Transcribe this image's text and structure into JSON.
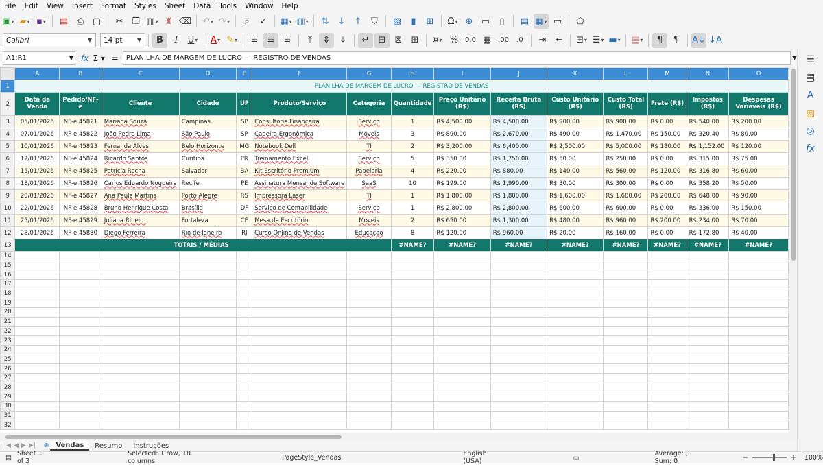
{
  "menu": [
    "File",
    "Edit",
    "View",
    "Insert",
    "Format",
    "Styles",
    "Sheet",
    "Data",
    "Tools",
    "Window",
    "Help"
  ],
  "toolbar": {
    "font_name": "Calibri",
    "font_size": "14 pt"
  },
  "formula_bar": {
    "name_box": "A1:R1",
    "content": "PLANILHA DE MARGEM DE LUCRO — REGISTRO DE VENDAS"
  },
  "columns": [
    "A",
    "B",
    "C",
    "D",
    "E",
    "F",
    "G",
    "H",
    "I",
    "J",
    "K",
    "L",
    "M",
    "N",
    "O"
  ],
  "title": "PLANILHA DE MARGEM DE LUCRO — REGISTRO DE VENDAS",
  "headers": [
    "Data da Venda",
    "Pedido/NF-e",
    "Cliente",
    "Cidade",
    "UF",
    "Produto/Serviço",
    "Categoria",
    "Quantidade",
    "Preço Unitário (R$)",
    "Receita Bruta (R$)",
    "Custo Unitário (R$)",
    "Custo Total (R$)",
    "Frete (R$)",
    "Impostos (R$)",
    "Despesas Variáveis (R$)"
  ],
  "rows": [
    [
      "05/01/2026",
      "NF-e 45821",
      "Mariana Souza",
      "Campinas",
      "SP",
      "Consultoria Financeira",
      "Serviço",
      "1",
      "R$ 4,500.00",
      "R$ 4,500.00",
      "R$ 900.00",
      "R$ 900.00",
      "R$ 0.00",
      "R$ 540.00",
      "R$ 200.00"
    ],
    [
      "07/01/2026",
      "NF-e 45822",
      "João Pedro Lima",
      "São Paulo",
      "SP",
      "Cadeira Ergonômica",
      "Móveis",
      "3",
      "R$ 890.00",
      "R$ 2,670.00",
      "R$ 490.00",
      "R$ 1,470.00",
      "R$ 150.00",
      "R$ 320.40",
      "R$ 80.00"
    ],
    [
      "10/01/2026",
      "NF-e 45823",
      "Fernanda Alves",
      "Belo Horizonte",
      "MG",
      "Notebook Dell",
      "TI",
      "2",
      "R$ 3,200.00",
      "R$ 6,400.00",
      "R$ 2,500.00",
      "R$ 5,000.00",
      "R$ 180.00",
      "R$ 1,152.00",
      "R$ 120.00"
    ],
    [
      "12/01/2026",
      "NF-e 45824",
      "Ricardo Santos",
      "Curitiba",
      "PR",
      "Treinamento Excel",
      "Serviço",
      "5",
      "R$ 350.00",
      "R$ 1,750.00",
      "R$ 50.00",
      "R$ 250.00",
      "R$ 0.00",
      "R$ 315.00",
      "R$ 75.00"
    ],
    [
      "15/01/2026",
      "NF-e 45825",
      "Patrícia Rocha",
      "Salvador",
      "BA",
      "Kit Escritório Premium",
      "Papelaria",
      "4",
      "R$ 220.00",
      "R$ 880.00",
      "R$ 140.00",
      "R$ 560.00",
      "R$ 120.00",
      "R$ 316.80",
      "R$ 60.00"
    ],
    [
      "18/01/2026",
      "NF-e 45826",
      "Carlos Eduardo Nogueira",
      "Recife",
      "PE",
      "Assinatura Mensal de Software",
      "SaaS",
      "10",
      "R$ 199.00",
      "R$ 1,990.00",
      "R$ 30.00",
      "R$ 300.00",
      "R$ 0.00",
      "R$ 358.20",
      "R$ 50.00"
    ],
    [
      "20/01/2026",
      "NF-e 45827",
      "Ana Paula Martins",
      "Porto Alegre",
      "RS",
      "Impressora Laser",
      "TI",
      "1",
      "R$ 1,800.00",
      "R$ 1,800.00",
      "R$ 1,600.00",
      "R$ 1,600.00",
      "R$ 200.00",
      "R$ 648.00",
      "R$ 90.00"
    ],
    [
      "22/01/2026",
      "NF-e 45828",
      "Bruno Henrique Costa",
      "Brasília",
      "DF",
      "Serviço de Contabilidade",
      "Serviço",
      "1",
      "R$ 2,800.00",
      "R$ 2,800.00",
      "R$ 600.00",
      "R$ 600.00",
      "R$ 0.00",
      "R$ 336.00",
      "R$ 150.00"
    ],
    [
      "25/01/2026",
      "NF-e 45829",
      "Juliana Ribeiro",
      "Fortaleza",
      "CE",
      "Mesa de Escritório",
      "Móveis",
      "2",
      "R$ 650.00",
      "R$ 1,300.00",
      "R$ 480.00",
      "R$ 960.00",
      "R$ 200.00",
      "R$ 234.00",
      "R$ 70.00"
    ],
    [
      "28/01/2026",
      "NF-e 45830",
      "Diego Ferreira",
      "Rio de Janeiro",
      "RJ",
      "Curso Online de Vendas",
      "Educação",
      "8",
      "R$ 120.00",
      "R$ 960.00",
      "R$ 20.00",
      "R$ 160.00",
      "R$ 0.00",
      "R$ 172.80",
      "R$ 40.00"
    ]
  ],
  "totals_label": "TOTAIS / MÉDIAS",
  "totals": [
    "#NAME?",
    "#NAME?",
    "#NAME?",
    "#NAME?",
    "#NAME?",
    "#NAME?",
    "#NAME?",
    "#NAME?"
  ],
  "sheet_tabs": [
    "Vendas",
    "Resumo",
    "Instruções"
  ],
  "status": {
    "sheet": "Sheet 1 of 3",
    "selection": "Selected: 1 row, 18 columns",
    "page_style": "PageStyle_Vendas",
    "language": "English (USA)",
    "summary": "Average: ; Sum: 0",
    "zoom": "100%"
  }
}
